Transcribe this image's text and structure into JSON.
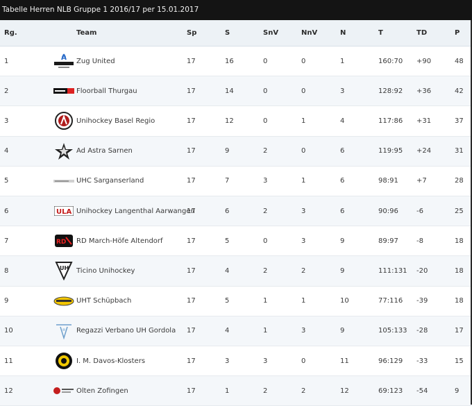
{
  "title": "Tabelle Herren NLB Gruppe 1 2016/17 per 15.01.2017",
  "columns": [
    "Rg.",
    "Team",
    "Sp",
    "S",
    "SnV",
    "NnV",
    "N",
    "T",
    "TD",
    "P"
  ],
  "rows": [
    {
      "rank": "1",
      "team": "Zug United",
      "sp": "17",
      "s": "16",
      "snv": "0",
      "nnv": "0",
      "n": "1",
      "t": "160:70",
      "td": "+90",
      "p": "48",
      "logo": "zug-united-logo"
    },
    {
      "rank": "2",
      "team": "Floorball Thurgau",
      "sp": "17",
      "s": "14",
      "snv": "0",
      "nnv": "0",
      "n": "3",
      "t": "128:92",
      "td": "+36",
      "p": "42",
      "logo": "floorball-thurgau-logo"
    },
    {
      "rank": "3",
      "team": "Unihockey Basel Regio",
      "sp": "17",
      "s": "12",
      "snv": "0",
      "nnv": "1",
      "n": "4",
      "t": "117:86",
      "td": "+31",
      "p": "37",
      "logo": "basel-regio-logo"
    },
    {
      "rank": "4",
      "team": "Ad Astra Sarnen",
      "sp": "17",
      "s": "9",
      "snv": "2",
      "nnv": "0",
      "n": "6",
      "t": "119:95",
      "td": "+24",
      "p": "31",
      "logo": "ad-astra-logo"
    },
    {
      "rank": "5",
      "team": "UHC Sarganserland",
      "sp": "17",
      "s": "7",
      "snv": "3",
      "nnv": "1",
      "n": "6",
      "t": "98:91",
      "td": "+7",
      "p": "28",
      "logo": "sarganserland-logo"
    },
    {
      "rank": "6",
      "team": "Unihockey Langenthal Aarwangen",
      "sp": "17",
      "s": "6",
      "snv": "2",
      "nnv": "3",
      "n": "6",
      "t": "90:96",
      "td": "-6",
      "p": "25",
      "logo": "langenthal-logo"
    },
    {
      "rank": "7",
      "team": "RD March-Höfe Altendorf",
      "sp": "17",
      "s": "5",
      "snv": "0",
      "nnv": "3",
      "n": "9",
      "t": "89:97",
      "td": "-8",
      "p": "18",
      "logo": "march-hoefe-logo"
    },
    {
      "rank": "8",
      "team": "Ticino Unihockey",
      "sp": "17",
      "s": "4",
      "snv": "2",
      "nnv": "2",
      "n": "9",
      "t": "111:131",
      "td": "-20",
      "p": "18",
      "logo": "ticino-logo"
    },
    {
      "rank": "9",
      "team": "UHT Schüpbach",
      "sp": "17",
      "s": "5",
      "snv": "1",
      "nnv": "1",
      "n": "10",
      "t": "77:116",
      "td": "-39",
      "p": "18",
      "logo": "schuepbach-logo"
    },
    {
      "rank": "10",
      "team": "Regazzi Verbano UH Gordola",
      "sp": "17",
      "s": "4",
      "snv": "1",
      "nnv": "3",
      "n": "9",
      "t": "105:133",
      "td": "-28",
      "p": "17",
      "logo": "gordola-logo"
    },
    {
      "rank": "11",
      "team": "I. M. Davos-Klosters",
      "sp": "17",
      "s": "3",
      "snv": "3",
      "nnv": "0",
      "n": "11",
      "t": "96:129",
      "td": "-33",
      "p": "15",
      "logo": "davos-klosters-logo"
    },
    {
      "rank": "12",
      "team": "Olten Zofingen",
      "sp": "17",
      "s": "1",
      "snv": "2",
      "nnv": "2",
      "n": "12",
      "t": "69:123",
      "td": "-54",
      "p": "9",
      "logo": "olten-zofingen-logo"
    }
  ],
  "colors": {
    "titlebar": "#141414",
    "header": "#edf2f6",
    "row_alt": "#f4f7fa",
    "text": "#3a3a3a"
  }
}
